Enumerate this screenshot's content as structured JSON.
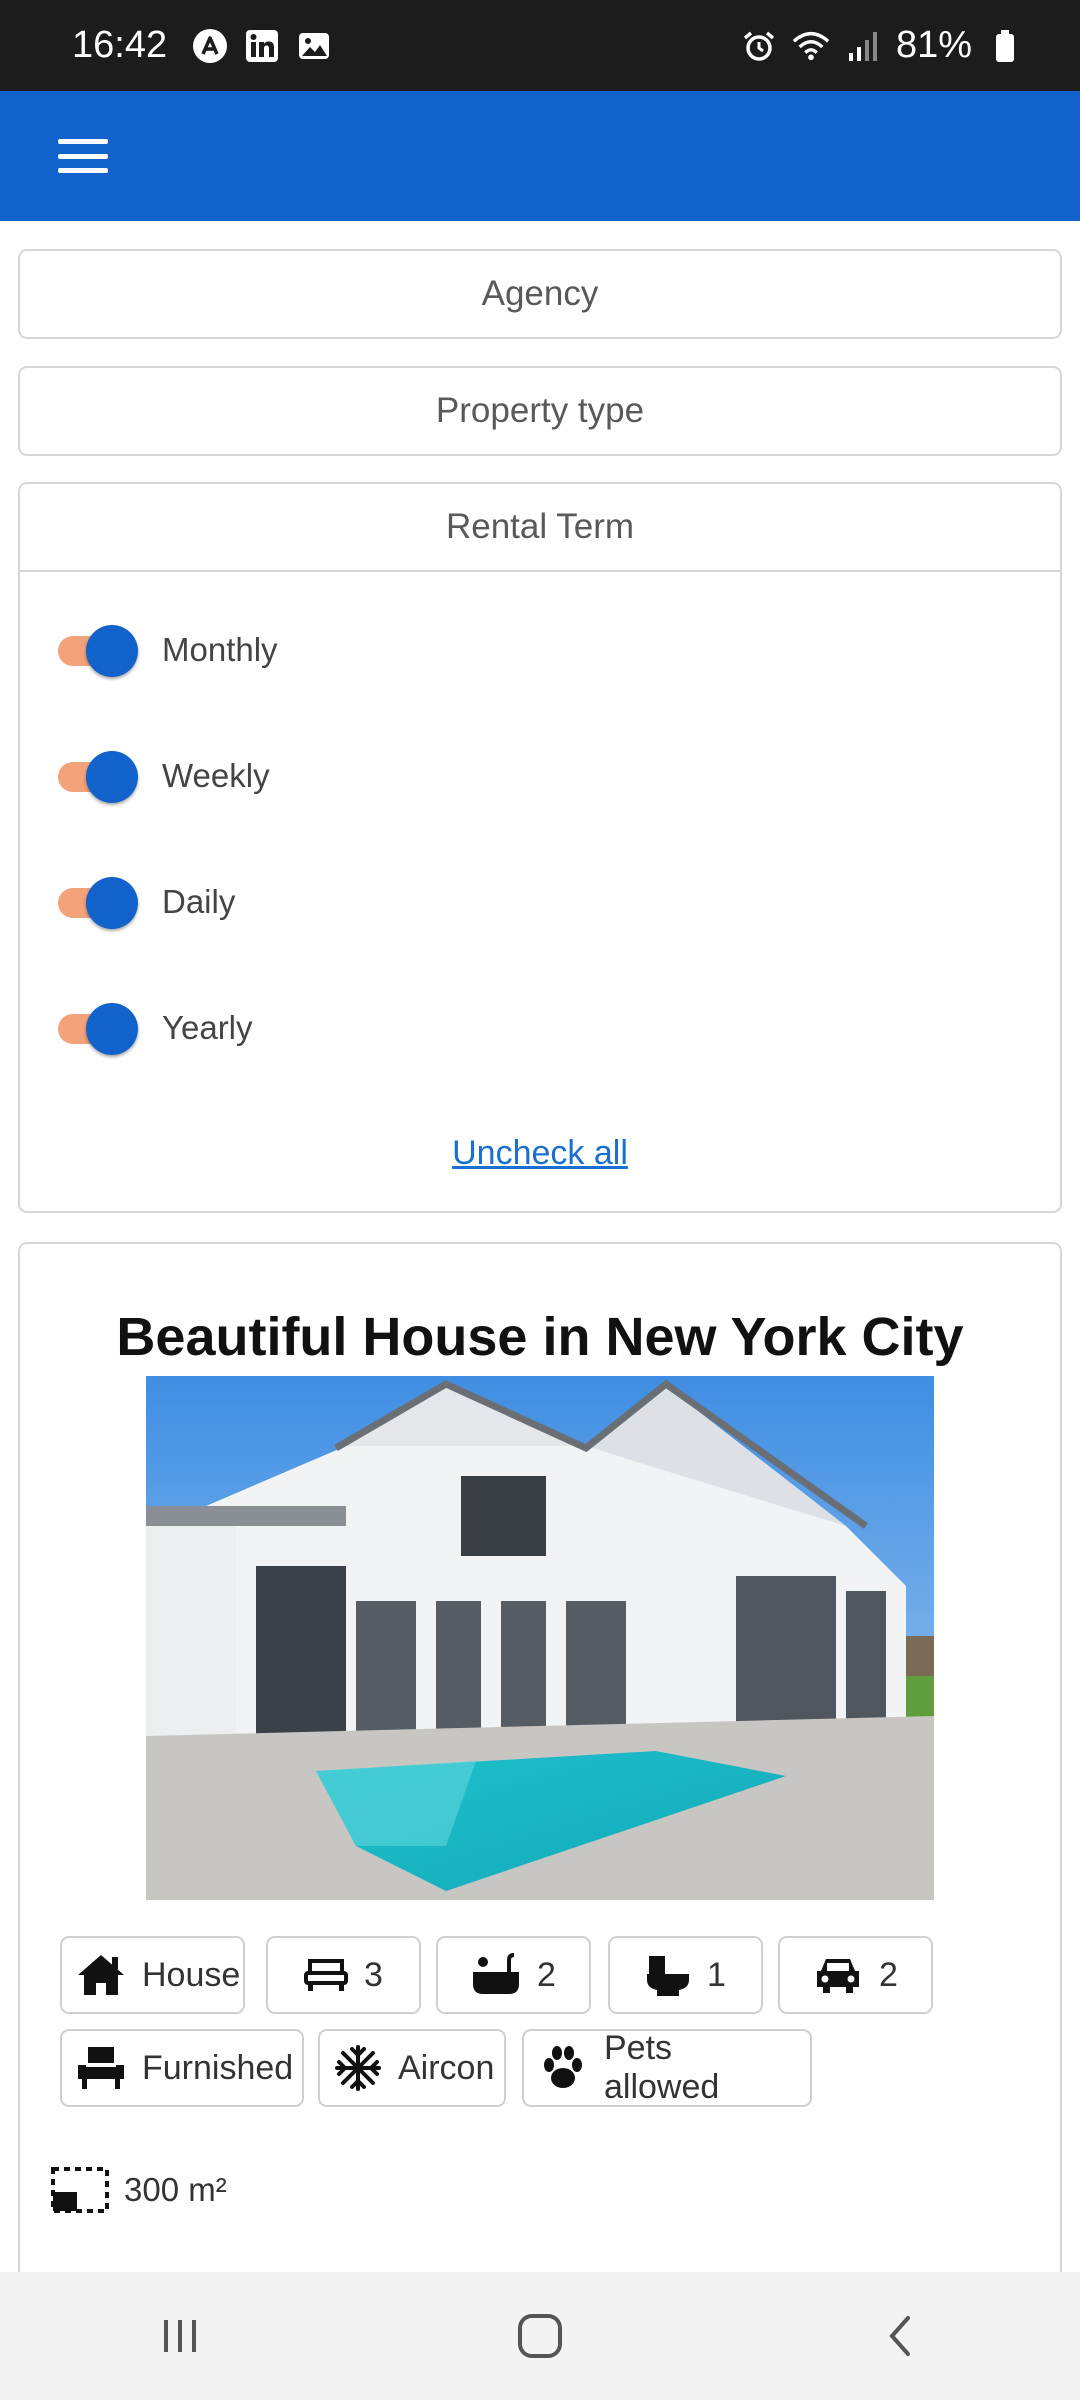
{
  "status_bar": {
    "time": "16:42",
    "battery": "81%",
    "left_icons": [
      "app-a-icon",
      "linkedin-icon",
      "gallery-icon"
    ],
    "right_icons": [
      "alarm-icon",
      "wifi-icon",
      "signal-icon",
      "battery-icon"
    ]
  },
  "app_bar": {
    "menu_icon": "hamburger-icon",
    "color": "#1262cc"
  },
  "filters": {
    "agency_label": "Agency",
    "property_type_label": "Property type",
    "rental_term": {
      "label": "Rental Term",
      "options": [
        {
          "label": "Monthly",
          "checked": true
        },
        {
          "label": "Weekly",
          "checked": true
        },
        {
          "label": "Daily",
          "checked": true
        },
        {
          "label": "Yearly",
          "checked": true
        }
      ],
      "uncheck_all": "Uncheck all"
    }
  },
  "listing": {
    "title": "Beautiful House in New York City",
    "features": [
      {
        "icon": "house-icon",
        "label": "House"
      },
      {
        "icon": "bed-icon",
        "label": "3"
      },
      {
        "icon": "bathtub-icon",
        "label": "2"
      },
      {
        "icon": "toilet-icon",
        "label": "1"
      },
      {
        "icon": "car-icon",
        "label": "2"
      }
    ],
    "amenities": [
      {
        "icon": "chair-icon",
        "label": "Furnished"
      },
      {
        "icon": "snowflake-icon",
        "label": "Aircon"
      },
      {
        "icon": "paw-icon",
        "label": "Pets allowed"
      }
    ],
    "area": "300 m²"
  },
  "nav_bar": {
    "buttons": [
      "recents-icon",
      "home-icon",
      "back-icon"
    ]
  },
  "colors": {
    "accent": "#1262cc",
    "toggle_track": "#f3a27a",
    "link": "#1a6fd1"
  }
}
